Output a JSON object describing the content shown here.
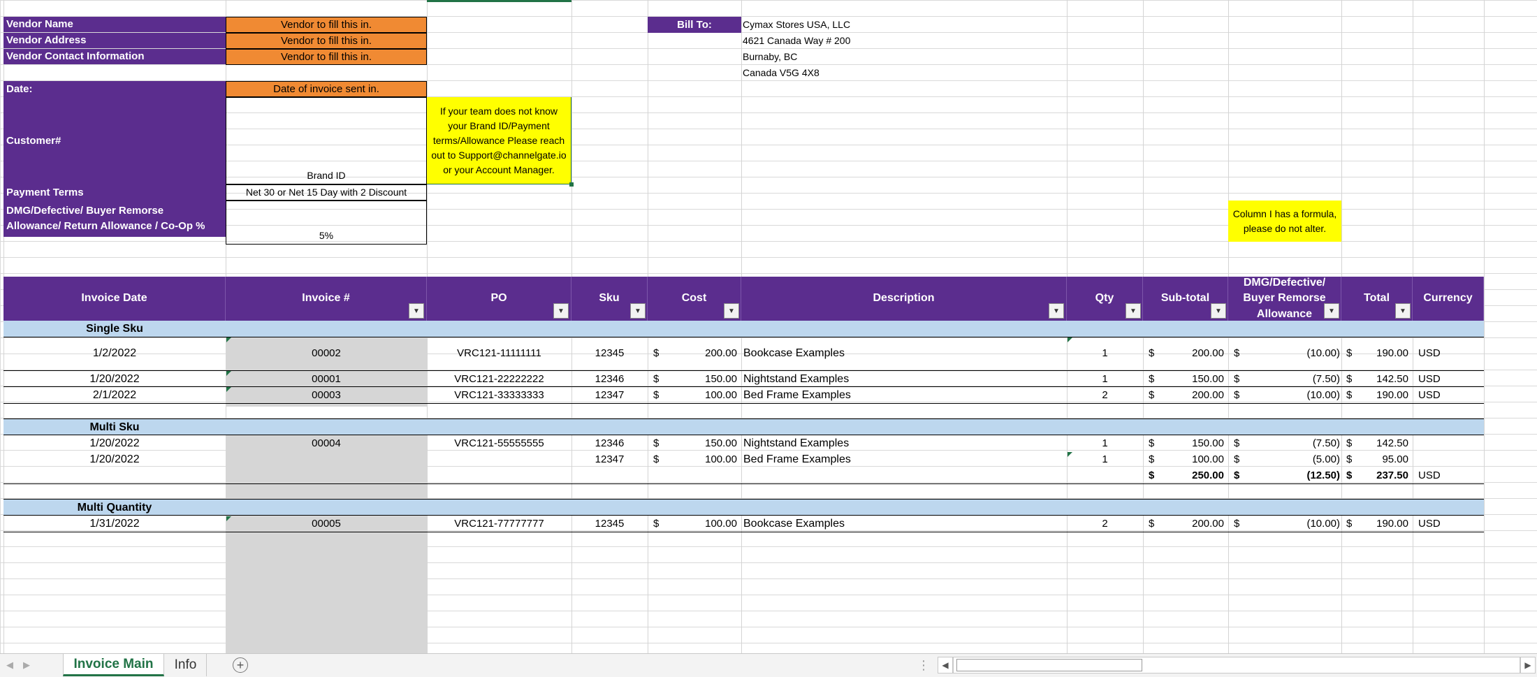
{
  "vendor": {
    "name_label": "Vendor Name",
    "address_label": "Vendor Address",
    "contact_label": "Vendor Contact Information",
    "fill_text": "Vendor to fill this in.",
    "date_label": "Date:",
    "date_value": "Date of invoice sent in.",
    "customer_label": "Customer#",
    "customer_value": "Brand ID",
    "payment_label": "Payment Terms",
    "payment_value": "Net 30 or Net 15 Day with 2 Discount",
    "allowance_label_1": "DMG/Defective/ Buyer Remorse",
    "allowance_label_2": "Allowance/ Return Allowance / Co-Op %",
    "allowance_value": "5%"
  },
  "bill_to": {
    "label": "Bill To:",
    "line1": "Cymax Stores USA, LLC",
    "line2": "4621 Canada Way # 200",
    "line3": "Burnaby, BC",
    "line4": "Canada V5G 4X8"
  },
  "notes": {
    "support_note": "If your team does not know your Brand ID/Payment terms/Allowance Please reach out to Support@channelgate.io or your Account Manager.",
    "formula_note": "Column I has a formula, please do not alter."
  },
  "table": {
    "headers": [
      "Invoice Date",
      "Invoice #",
      "PO",
      "Sku",
      "Cost",
      "Description",
      "Qty",
      "Sub-total",
      "DMG/Defective/ Buyer Remorse Allowance",
      "Total",
      "Currency"
    ],
    "sections": {
      "single": "Single Sku",
      "multi": "Multi Sku",
      "multiqty": "Multi Quantity"
    },
    "rows": [
      {
        "date": "1/2/2022",
        "inv": "00002",
        "po": "VRC121-11111111",
        "sku": "12345",
        "cost": "200.00",
        "desc": "Bookcase Examples",
        "qty": "1",
        "sub": "200.00",
        "allow": "(10.00)",
        "total": "190.00",
        "cur": "USD"
      },
      {
        "date": "1/20/2022",
        "inv": "00001",
        "po": "VRC121-22222222",
        "sku": "12346",
        "cost": "150.00",
        "desc": "Nightstand Examples",
        "qty": "1",
        "sub": "150.00",
        "allow": "(7.50)",
        "total": "142.50",
        "cur": "USD"
      },
      {
        "date": "2/1/2022",
        "inv": "00003",
        "po": "VRC121-33333333",
        "sku": "12347",
        "cost": "100.00",
        "desc": "Bed Frame Examples",
        "qty": "2",
        "sub": "200.00",
        "allow": "(10.00)",
        "total": "190.00",
        "cur": "USD"
      },
      {
        "date": "1/20/2022",
        "inv": "00004",
        "po": "VRC121-55555555",
        "sku": "12346",
        "cost": "150.00",
        "desc": "Nightstand Examples",
        "qty": "1",
        "sub": "150.00",
        "allow": "(7.50)",
        "total": "142.50",
        "cur": ""
      },
      {
        "date": "1/20/2022",
        "inv": "",
        "po": "",
        "sku": "12347",
        "cost": "100.00",
        "desc": "Bed Frame Examples",
        "qty": "1",
        "sub": "100.00",
        "allow": "(5.00)",
        "total": "95.00",
        "cur": ""
      },
      {
        "date": "",
        "inv": "",
        "po": "",
        "sku": "",
        "cost": "",
        "desc": "",
        "qty": "",
        "sub": "250.00",
        "allow": "(12.50)",
        "total": "237.50",
        "cur": "USD"
      },
      {
        "date": "1/31/2022",
        "inv": "00005",
        "po": "VRC121-77777777",
        "sku": "12345",
        "cost": "100.00",
        "desc": "Bookcase Examples",
        "qty": "2",
        "sub": "200.00",
        "allow": "(10.00)",
        "total": "190.00",
        "cur": "USD"
      }
    ]
  },
  "tabs": {
    "active": "Invoice Main",
    "other": "Info",
    "add": "+"
  },
  "colors": {
    "purple": "#5b2d8e",
    "orange": "#f08a33",
    "yellow": "#ffff00",
    "light_blue": "#bdd7ee",
    "tab_green": "#217346"
  }
}
